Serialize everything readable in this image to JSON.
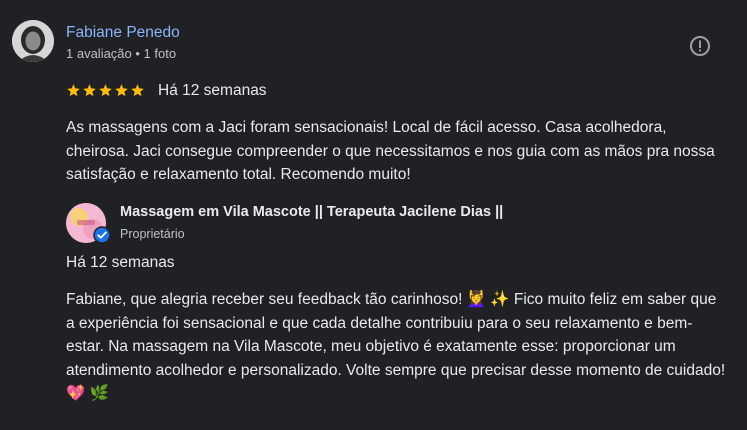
{
  "review": {
    "reviewer_name": "Fabiane Penedo",
    "reviewer_meta": "1 avaliação • 1 foto",
    "rating": 5,
    "date": "Há 12 semanas",
    "text": "As massagens com a Jaci foram sensacionais! Local de fácil acesso. Casa acolhedora, cheirosa. Jaci consegue compreender o que necessitamos e nos guia com as mãos pra nossa satisfação e relaxamento total. Recomendo muito!"
  },
  "reply": {
    "owner_name": "Massagem em Vila Mascote || Terapeuta Jacilene Dias ||",
    "owner_role": "Proprietário",
    "date": "Há 12 semanas",
    "text": "Fabiane, que alegria receber seu feedback tão carinhoso! 💆‍♀️ ✨ Fico muito feliz em saber que a experiência foi sensacional e que cada detalhe contribuiu para o seu relaxamento e bem-estar. Na massagem na Vila Mascote, meu objetivo é exatamente esse: proporcionar um atendimento acolhedor e personalizado. Volte sempre que precisar desse momento de cuidado! 💖 🌿"
  },
  "colors": {
    "background": "#202124",
    "link_blue": "#8ab4f8",
    "star_gold": "#fbbc04",
    "secondary_text": "#bdc1c6",
    "verified_blue": "#1a73e8"
  },
  "icons": {
    "report": "report-flag-icon",
    "star": "star-icon",
    "verified": "verified-check-icon"
  }
}
